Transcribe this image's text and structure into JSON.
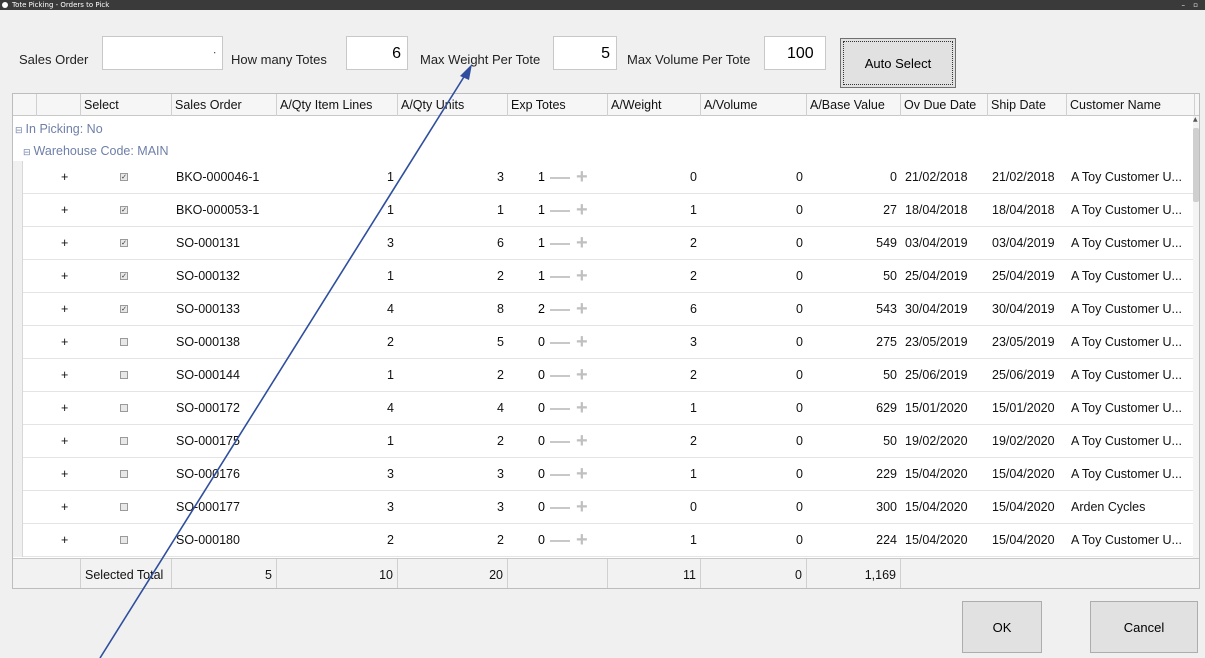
{
  "window": {
    "title": "Tote Picking - Orders to Pick",
    "controls": "– ▫"
  },
  "filters": {
    "sales_order_label": "Sales Order",
    "sales_order_value": "",
    "how_many_totes_label": "How many Totes",
    "how_many_totes_value": "6",
    "max_weight_label": "Max Weight Per Tote",
    "max_weight_value": "5",
    "max_volume_label": "Max Volume Per Tote",
    "max_volume_value": "100",
    "auto_select_label": "Auto Select"
  },
  "grid": {
    "columns": [
      "Select",
      "Sales Order",
      "A/Qty Item Lines",
      "A/Qty Units",
      "Exp Totes",
      "A/Weight",
      "A/Volume",
      "A/Base Value",
      "Ov Due Date",
      "Ship Date",
      "Customer Name"
    ],
    "group1": "In Picking: No",
    "group2": "Warehouse Code: MAIN",
    "rows": [
      {
        "expand": "+",
        "checked": true,
        "sales_order": "BKO-000046-1",
        "item_lines": "1",
        "units": "3",
        "exp_totes": "1",
        "weight": "0",
        "volume": "0",
        "base_value": "0",
        "ov_due": "21/02/2018",
        "ship": "21/02/2018",
        "customer": "A Toy Customer U..."
      },
      {
        "expand": "+",
        "checked": true,
        "sales_order": "BKO-000053-1",
        "item_lines": "1",
        "units": "1",
        "exp_totes": "1",
        "weight": "1",
        "volume": "0",
        "base_value": "27",
        "ov_due": "18/04/2018",
        "ship": "18/04/2018",
        "customer": "A Toy Customer U..."
      },
      {
        "expand": "+",
        "checked": true,
        "sales_order": "SO-000131",
        "item_lines": "3",
        "units": "6",
        "exp_totes": "1",
        "weight": "2",
        "volume": "0",
        "base_value": "549",
        "ov_due": "03/04/2019",
        "ship": "03/04/2019",
        "customer": "A Toy Customer U..."
      },
      {
        "expand": "+",
        "checked": true,
        "sales_order": "SO-000132",
        "item_lines": "1",
        "units": "2",
        "exp_totes": "1",
        "weight": "2",
        "volume": "0",
        "base_value": "50",
        "ov_due": "25/04/2019",
        "ship": "25/04/2019",
        "customer": "A Toy Customer U..."
      },
      {
        "expand": "+",
        "checked": true,
        "sales_order": "SO-000133",
        "item_lines": "4",
        "units": "8",
        "exp_totes": "2",
        "weight": "6",
        "volume": "0",
        "base_value": "543",
        "ov_due": "30/04/2019",
        "ship": "30/04/2019",
        "customer": "A Toy Customer U..."
      },
      {
        "expand": "+",
        "checked": false,
        "sales_order": "SO-000138",
        "item_lines": "2",
        "units": "5",
        "exp_totes": "0",
        "weight": "3",
        "volume": "0",
        "base_value": "275",
        "ov_due": "23/05/2019",
        "ship": "23/05/2019",
        "customer": "A Toy Customer U..."
      },
      {
        "expand": "+",
        "checked": false,
        "sales_order": "SO-000144",
        "item_lines": "1",
        "units": "2",
        "exp_totes": "0",
        "weight": "2",
        "volume": "0",
        "base_value": "50",
        "ov_due": "25/06/2019",
        "ship": "25/06/2019",
        "customer": "A Toy Customer U..."
      },
      {
        "expand": "+",
        "checked": false,
        "sales_order": "SO-000172",
        "item_lines": "4",
        "units": "4",
        "exp_totes": "0",
        "weight": "1",
        "volume": "0",
        "base_value": "629",
        "ov_due": "15/01/2020",
        "ship": "15/01/2020",
        "customer": "A Toy Customer U..."
      },
      {
        "expand": "+",
        "checked": false,
        "sales_order": "SO-000175",
        "item_lines": "1",
        "units": "2",
        "exp_totes": "0",
        "weight": "2",
        "volume": "0",
        "base_value": "50",
        "ov_due": "19/02/2020",
        "ship": "19/02/2020",
        "customer": "A Toy Customer U..."
      },
      {
        "expand": "+",
        "checked": false,
        "sales_order": "SO-000176",
        "item_lines": "3",
        "units": "3",
        "exp_totes": "0",
        "weight": "1",
        "volume": "0",
        "base_value": "229",
        "ov_due": "15/04/2020",
        "ship": "15/04/2020",
        "customer": "A Toy Customer U..."
      },
      {
        "expand": "+",
        "checked": false,
        "sales_order": "SO-000177",
        "item_lines": "3",
        "units": "3",
        "exp_totes": "0",
        "weight": "0",
        "volume": "0",
        "base_value": "300",
        "ov_due": "15/04/2020",
        "ship": "15/04/2020",
        "customer": "Arden Cycles"
      },
      {
        "expand": "+",
        "checked": false,
        "sales_order": "SO-000180",
        "item_lines": "2",
        "units": "2",
        "exp_totes": "0",
        "weight": "1",
        "volume": "0",
        "base_value": "224",
        "ov_due": "15/04/2020",
        "ship": "15/04/2020",
        "customer": "A Toy Customer U..."
      }
    ],
    "footer": {
      "label": "Selected Total",
      "sales_order": "5",
      "item_lines": "10",
      "units": "20",
      "weight": "11",
      "volume": "0",
      "base_value": "1,169"
    }
  },
  "buttons": {
    "ok": "OK",
    "cancel": "Cancel"
  },
  "colors": {
    "group_text": "#6e7fa8",
    "annotation_arrow": "#2f4f9e"
  }
}
